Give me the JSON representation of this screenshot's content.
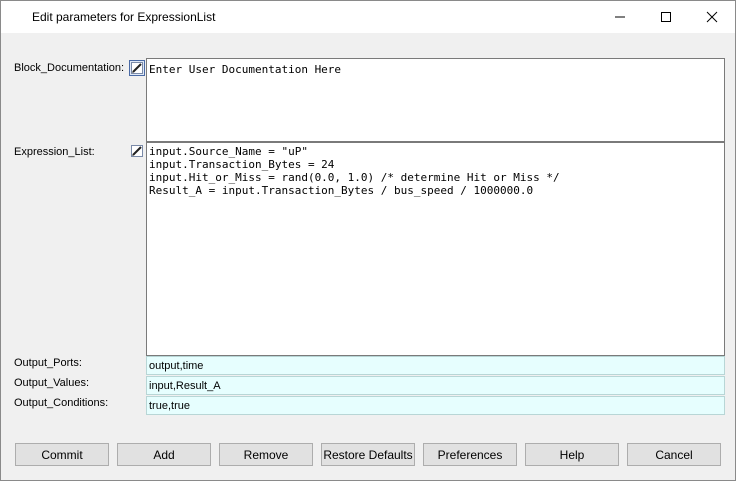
{
  "window": {
    "title": "Edit parameters for ExpressionList"
  },
  "fields": {
    "block_documentation": {
      "label": "Block_Documentation:",
      "value": "Enter User Documentation Here"
    },
    "expression_list": {
      "label": "Expression_List:",
      "lines": [
        "input.Source_Name = \"uP\"",
        "input.Transaction_Bytes = 24",
        "input.Hit_or_Miss = rand(0.0, 1.0) /* determine Hit or Miss */",
        "Result_A = input.Transaction_Bytes / bus_speed / 1000000.0"
      ]
    },
    "output_ports": {
      "label": "Output_Ports:",
      "value": "output,time"
    },
    "output_values": {
      "label": "Output_Values:",
      "value": "input,Result_A"
    },
    "output_conditions": {
      "label": "Output_Conditions:",
      "value": "true,true"
    }
  },
  "buttons": {
    "commit": "Commit",
    "add": "Add",
    "remove": "Remove",
    "restore_defaults": "Restore Defaults",
    "preferences": "Preferences",
    "help": "Help",
    "cancel": "Cancel"
  },
  "icons": {
    "title": "app-icon",
    "minimize": "minimize-icon",
    "maximize": "maximize-icon",
    "close": "close-icon",
    "edit": "edit-pencil-icon"
  },
  "colors": {
    "field_background": "#e6fefe",
    "dialog_background": "#f0f0f0"
  }
}
